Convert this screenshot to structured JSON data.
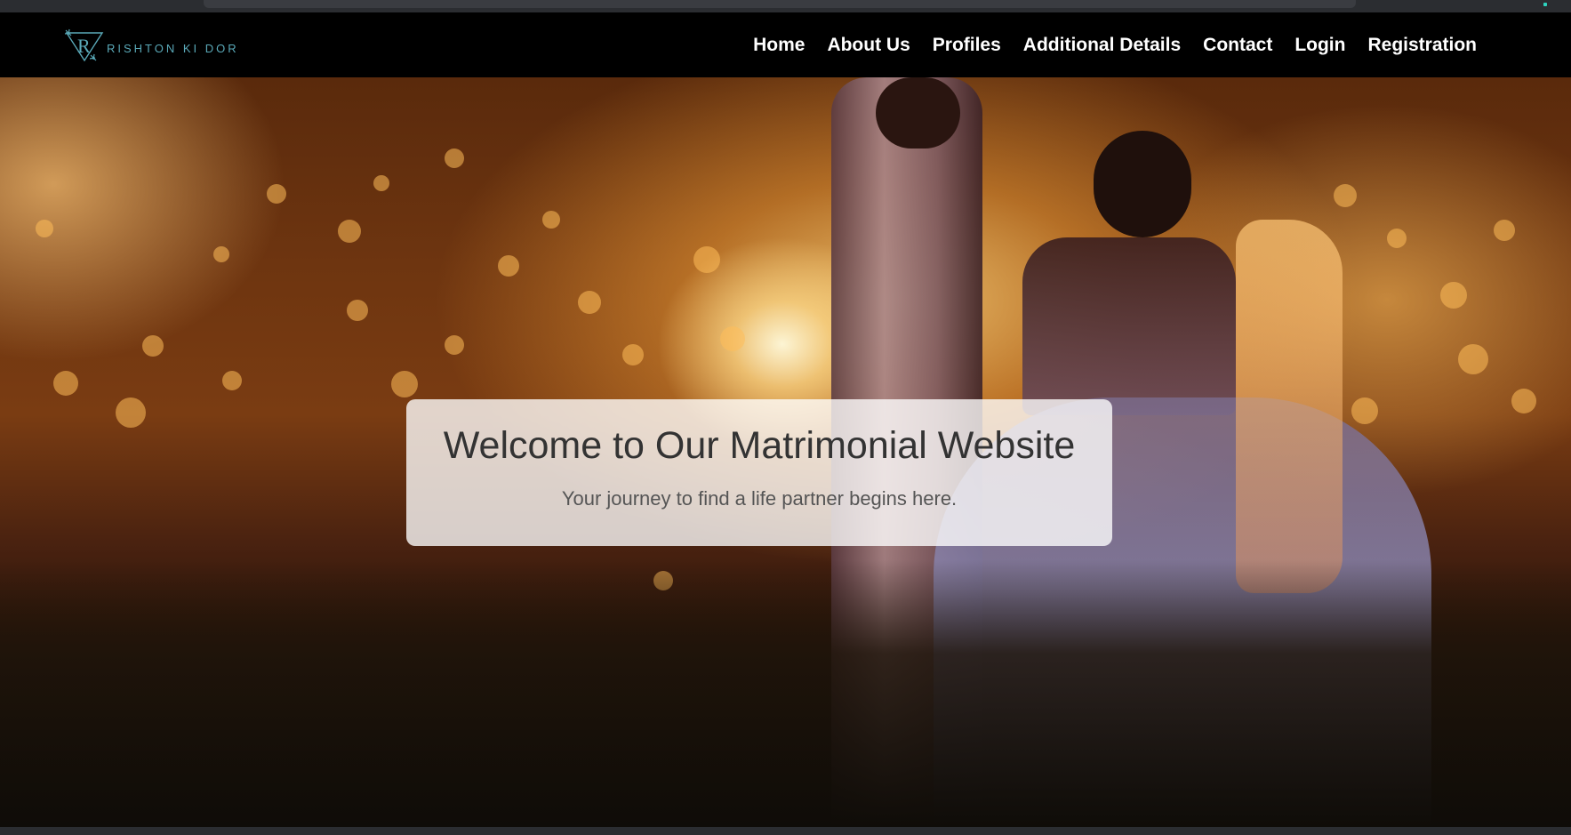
{
  "brand": {
    "logo_letter": "R",
    "name": "RISHTON KI DOR",
    "color": "#5aa9b8"
  },
  "nav": {
    "items": [
      {
        "label": "Home"
      },
      {
        "label": "About Us"
      },
      {
        "label": "Profiles"
      },
      {
        "label": "Additional Details"
      },
      {
        "label": "Contact"
      },
      {
        "label": "Login"
      },
      {
        "label": "Registration"
      }
    ]
  },
  "hero": {
    "image_subject": "wedding-couple-sunset",
    "title": "Welcome to Our Matrimonial Website",
    "subtitle": "Your journey to find a life partner begins here."
  },
  "colors": {
    "navbar_bg": "#000000",
    "nav_text": "#ffffff",
    "box_bg": "rgba(255,255,255,0.78)",
    "title_text": "#333333"
  }
}
